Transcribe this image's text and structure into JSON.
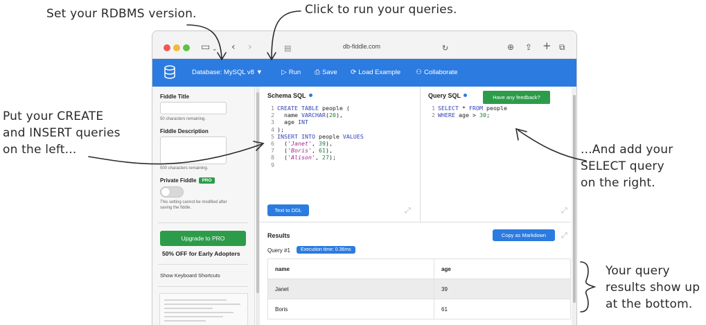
{
  "annotations": {
    "rdbms": "Set your RDBMS version.",
    "run": "Click to run your queries.",
    "left": [
      "Put your CREATE",
      "and INSERT queries",
      "on the left..."
    ],
    "right": [
      "...And add your",
      "SELECT query",
      "on the right."
    ],
    "bottom": [
      "Your query",
      "results show up",
      "at the bottom."
    ]
  },
  "browser": {
    "url": "db-fiddle.com",
    "icons": [
      "sidebar-icon",
      "back-icon",
      "forward-icon",
      "share-icon",
      "reload-icon",
      "download-icon",
      "new-tab-icon",
      "tabs-icon"
    ]
  },
  "navbar": {
    "database": "Database: MySQL v8",
    "run": "Run",
    "save": "Save",
    "load_example": "Load Example",
    "collaborate": "Collaborate",
    "accent": "#2c7be0"
  },
  "sidebar": {
    "title_label": "Fiddle Title",
    "title_chars": "50 characters remaining.",
    "description_label": "Fiddle Description",
    "description_chars": "500 characters remaining.",
    "private_label": "Private Fiddle",
    "pro_badge": "PRO",
    "private_note_1": "This setting cannot be modified after",
    "private_note_2": "saving the fiddle.",
    "upgrade": "Upgrade to PRO",
    "early": "50% OFF for Early Adopters",
    "shortcuts": "Show Keyboard Shortcuts"
  },
  "schema": {
    "title": "Schema SQL",
    "text_to_ddl": "Text to DDL"
  },
  "query": {
    "title": "Query SQL",
    "feedback": "Have any feedback?"
  },
  "results": {
    "title": "Results",
    "copy": "Copy as Markdown",
    "query_num": "Query #1",
    "exec_time": "Execution time: 0.36ms",
    "columns": [
      "name",
      "age"
    ],
    "rows": [
      [
        "Janet",
        "39"
      ],
      [
        "Boris",
        "61"
      ]
    ]
  }
}
